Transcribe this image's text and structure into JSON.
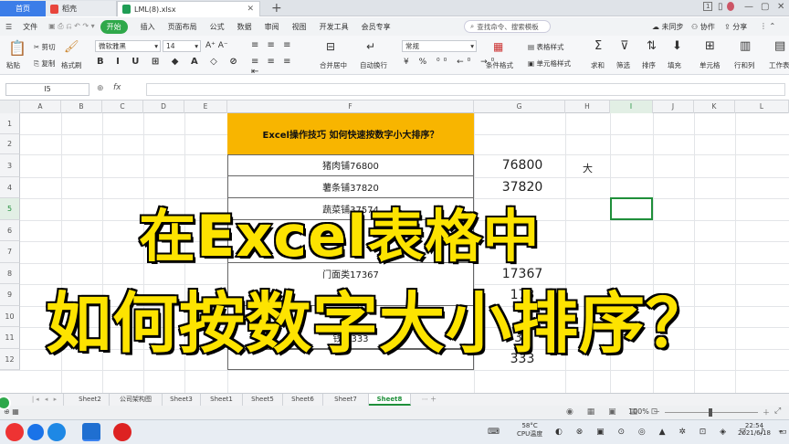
{
  "tabs": {
    "home": "首页",
    "tab1": "稻壳",
    "tab2": "LML(8).xlsx",
    "badge": "1"
  },
  "menubar": {
    "file": "文件",
    "start": "开始",
    "items": [
      "插入",
      "页面布局",
      "公式",
      "数据",
      "审阅",
      "视图",
      "开发工具",
      "会员专享"
    ],
    "search": "查找命令、搜索模板",
    "sync": "未同步",
    "collab": "协作",
    "share": "分享"
  },
  "ribbon": {
    "paste": "粘贴",
    "cut": "剪切",
    "copy": "复制",
    "format_painter": "格式刷",
    "font_name": "微软雅黑",
    "font_size": "14",
    "number_format": "常规",
    "merge": "合并居中",
    "wrap": "自动换行",
    "cond_format": "条件格式",
    "table_style": "表格样式",
    "cell_style": "单元格样式",
    "sum": "求和",
    "filter": "筛选",
    "sort": "排序",
    "fill": "填充",
    "cell": "单元格",
    "rowcol": "行和列",
    "sheet": "工作表"
  },
  "formula_bar": {
    "name_box": "I5",
    "fx": "fx",
    "content": ""
  },
  "grid": {
    "columns": [
      "A",
      "B",
      "C",
      "D",
      "E",
      "F",
      "G",
      "H",
      "I",
      "J",
      "K",
      "L"
    ],
    "rows": [
      "1",
      "2",
      "3",
      "4",
      "5",
      "6",
      "7",
      "8",
      "9",
      "10",
      "11",
      "12"
    ],
    "title": "Excel操作技巧 如何快速按数字小大排序？",
    "f_cells": [
      "猪肉铺76800",
      "薯条铺37820",
      "蔬菜铺37574",
      "",
      "",
      "门面类17367",
      "",
      "",
      "钱铺333"
    ],
    "g_cells": [
      "76800",
      "37820",
      "",
      "",
      "",
      "17367",
      "173",
      "1",
      "33",
      "333"
    ],
    "h3": "大"
  },
  "overlay": {
    "line1": "在Excel表格中",
    "line2": "如何按数字大小排序？"
  },
  "sheet_tabs": [
    "Sheet2",
    "公司架构图",
    "Sheet3",
    "Sheet1",
    "Sheet5",
    "Sheet6",
    "Sheet7",
    "Sheet8"
  ],
  "status": {
    "zoom": "100%"
  },
  "taskbar": {
    "temp": "58°C",
    "cpu": "CPU温度",
    "time": "22:54",
    "date": "2021/6/18"
  },
  "colors": {
    "accent_green": "#1f8f3a",
    "title_fill": "#f8b500",
    "overlay_yellow": "#fde300",
    "tab_blue": "#3b7de8"
  }
}
